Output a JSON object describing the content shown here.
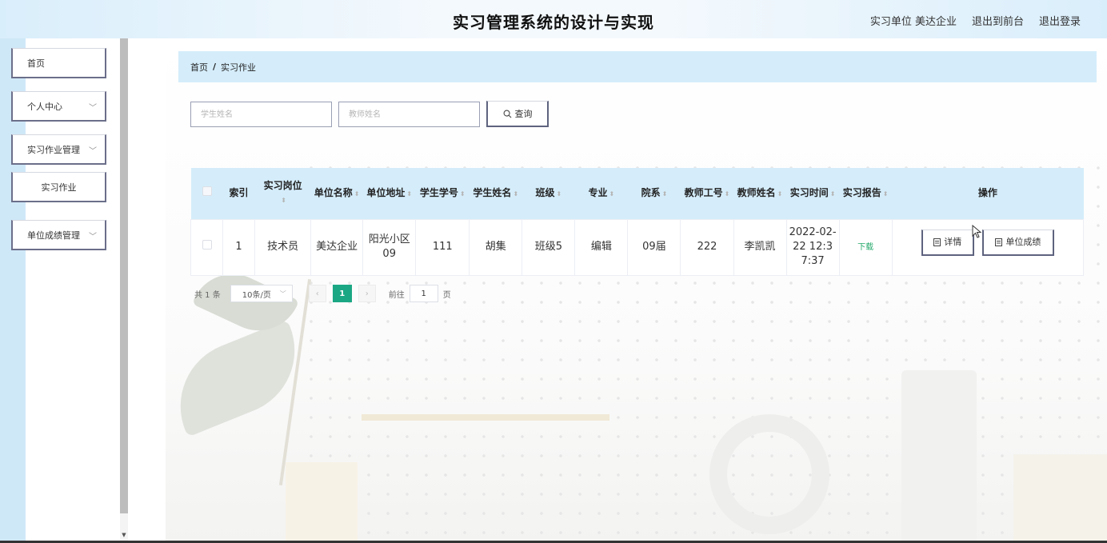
{
  "header": {
    "title": "实习管理系统的设计与实现",
    "user_label": "实习单位 美达企业",
    "to_front": "退出到前台",
    "logout": "退出登录"
  },
  "sidebar": {
    "items": [
      {
        "label": "首页"
      },
      {
        "label": "个人中心"
      },
      {
        "label": "实习作业管理"
      },
      {
        "label": "实习作业"
      },
      {
        "label": "单位成绩管理"
      }
    ]
  },
  "breadcrumb": {
    "home": "首页",
    "separator": "/",
    "current": "实习作业"
  },
  "search": {
    "student_placeholder": "学生姓名",
    "teacher_placeholder": "教师姓名",
    "button": "查询"
  },
  "table": {
    "columns": [
      "索引",
      "实习岗位",
      "单位名称",
      "单位地址",
      "学生学号",
      "学生姓名",
      "班级",
      "专业",
      "院系",
      "教师工号",
      "教师姓名",
      "实习时间",
      "实习报告",
      "操作"
    ],
    "rows": [
      {
        "index": "1",
        "position": "技术员",
        "company": "美达企业",
        "address": "阳光小区09",
        "student_no": "111",
        "student_name": "胡集",
        "class": "班级5",
        "major": "编辑",
        "department": "09届",
        "teacher_no": "222",
        "teacher_name": "李凯凯",
        "time": "2022-02-22 12:37:37",
        "report": "下载",
        "detail_btn": "详情",
        "score_btn": "单位成绩"
      }
    ]
  },
  "pagination": {
    "total": "共 1 条",
    "page_size": "10条/页",
    "current_page": "1",
    "goto_label": "前往",
    "goto_value": "1",
    "page_suffix": "页"
  },
  "colors": {
    "accent_green": "#1ba784",
    "header_bg": "#d5edfb",
    "button_border": "#5e637e"
  }
}
